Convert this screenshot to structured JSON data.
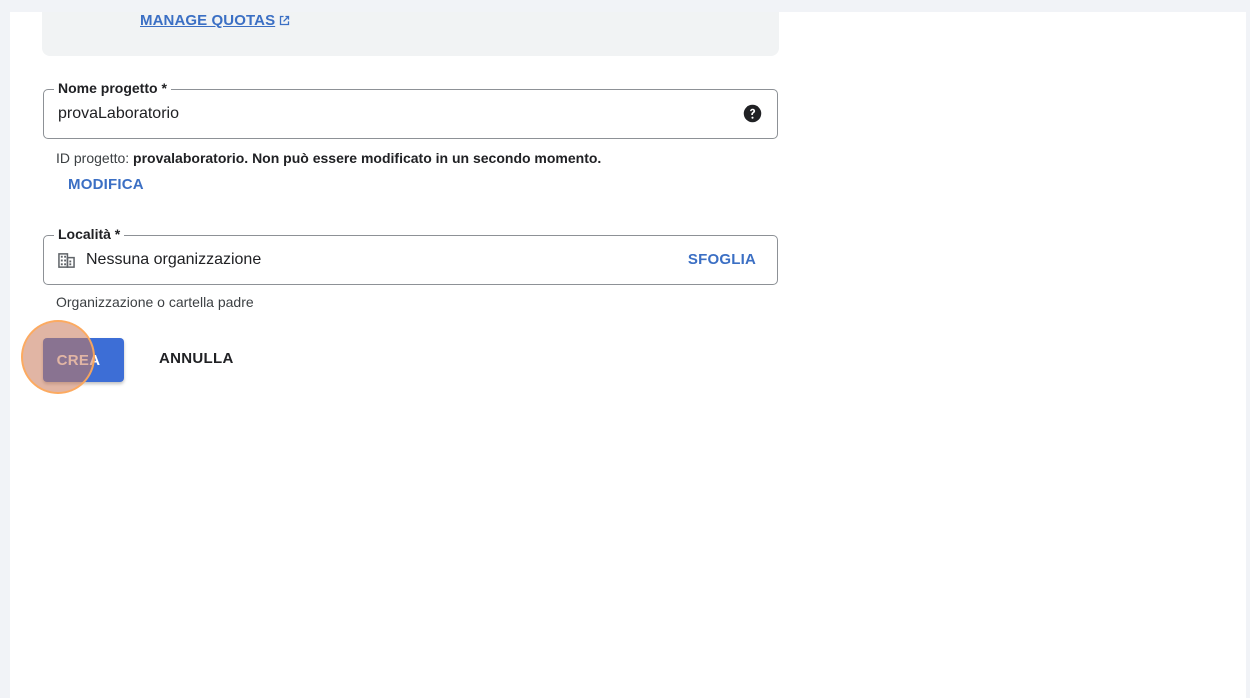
{
  "quota": {
    "link_label": "MANAGE QUOTAS",
    "link_icon": "external-link-icon"
  },
  "project_name": {
    "label": "Nome progetto *",
    "value": "provaLaboratorio",
    "help_icon": "help-circle-icon"
  },
  "project_id": {
    "prefix": "ID progetto: ",
    "text": "provalaboratorio. Non può essere modificato in un secondo momento.",
    "edit_label": "MODIFICA"
  },
  "location": {
    "label": "Località *",
    "icon": "building-icon",
    "value": "Nessuna organizzazione",
    "browse_label": "SFOGLIA",
    "helper": "Organizzazione o cartella padre"
  },
  "actions": {
    "create_label": "CREA",
    "cancel_label": "ANNULLA"
  },
  "colors": {
    "accent": "#3b6fc4",
    "primary_button": "#3d6ed6",
    "background": "#f1f3f7",
    "click_indicator": "#e8a063"
  }
}
